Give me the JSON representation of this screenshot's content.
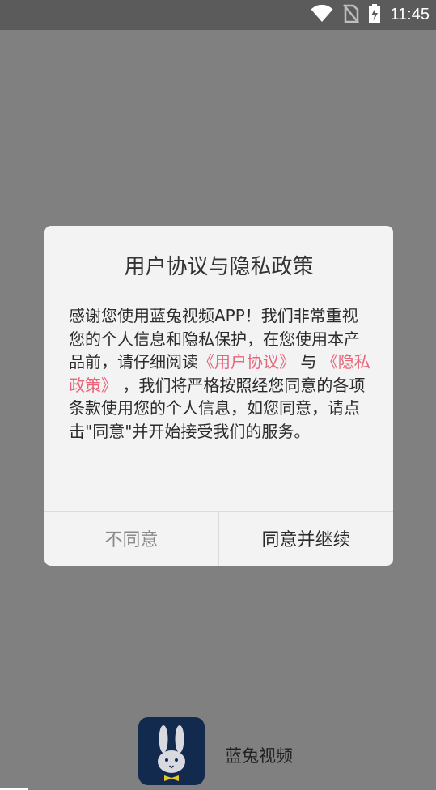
{
  "statusbar": {
    "time": "11:45",
    "icons": [
      "wifi-icon",
      "no-sim-icon",
      "battery-charging-icon"
    ]
  },
  "dialog": {
    "title": "用户协议与隐私政策",
    "body_intro": "感谢您使用蓝兔视频APP！我们非常重视您的个人信息和隐私保护，在您使用本产品前，请仔细阅读",
    "link_user_agreement": "《用户协议》",
    "connector": " 与 ",
    "link_privacy_policy": "《隐私政策》",
    "body_outro": " ，我们将严格按照经您同意的各项条款使用您的个人信息，如您同意，请点击\"同意\"并开始接受我们的服务。",
    "disagree_label": "不同意",
    "agree_label": "同意并继续"
  },
  "footer": {
    "app_name": "蓝兔视频"
  },
  "colors": {
    "overlay": "#808080",
    "link": "#e8657a",
    "logo_bg": "#122a4e"
  }
}
